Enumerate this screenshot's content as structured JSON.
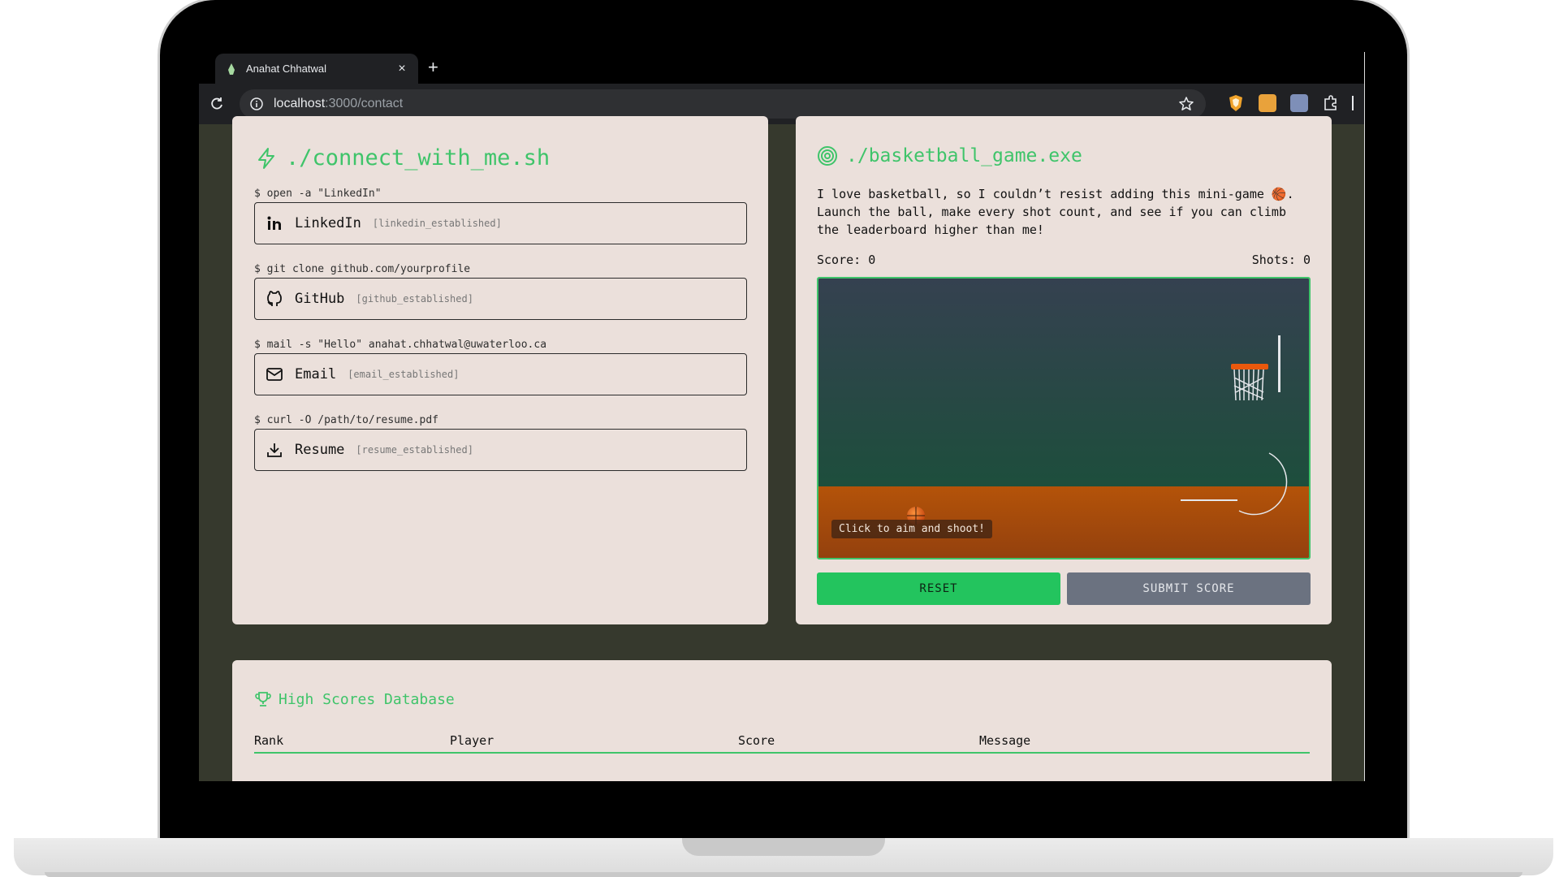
{
  "browser": {
    "tab_title": "Anahat Chhatwal",
    "tab_close": "×",
    "new_tab": "+",
    "url_host": "localhost",
    "url_path": ":3000/contact"
  },
  "connect": {
    "title": "./connect_with_me.sh",
    "links": [
      {
        "command": "$ open -a \"LinkedIn\"",
        "name": "LinkedIn",
        "status": "[linkedin_established]"
      },
      {
        "command": "$ git clone github.com/yourprofile",
        "name": "GitHub",
        "status": "[github_established]"
      },
      {
        "command": "$ mail -s \"Hello\" anahat.chhatwal@uwaterloo.ca",
        "name": "Email",
        "status": "[email_established]"
      },
      {
        "command": "$ curl -O /path/to/resume.pdf",
        "name": "Resume",
        "status": "[resume_established]"
      }
    ]
  },
  "game": {
    "title": "./basketball_game.exe",
    "description": "I love basketball, so I couldn’t resist adding this mini-game 🏀. Launch the ball, make every shot count, and see if you can climb the leaderboard higher than me!",
    "score_label": "Score: 0",
    "shots_label": "Shots: 0",
    "hint": "Click to aim and shoot!",
    "reset_label": "RESET",
    "submit_label": "SUBMIT SCORE"
  },
  "high_scores": {
    "title": "High Scores Database",
    "columns": [
      "Rank",
      "Player",
      "Score",
      "Message"
    ]
  },
  "colors": {
    "accent": "#3fc46a",
    "page_bg": "#36392d",
    "card_bg": "#ebe0db",
    "reset_btn": "#23c45e",
    "submit_btn": "#6b7280"
  }
}
